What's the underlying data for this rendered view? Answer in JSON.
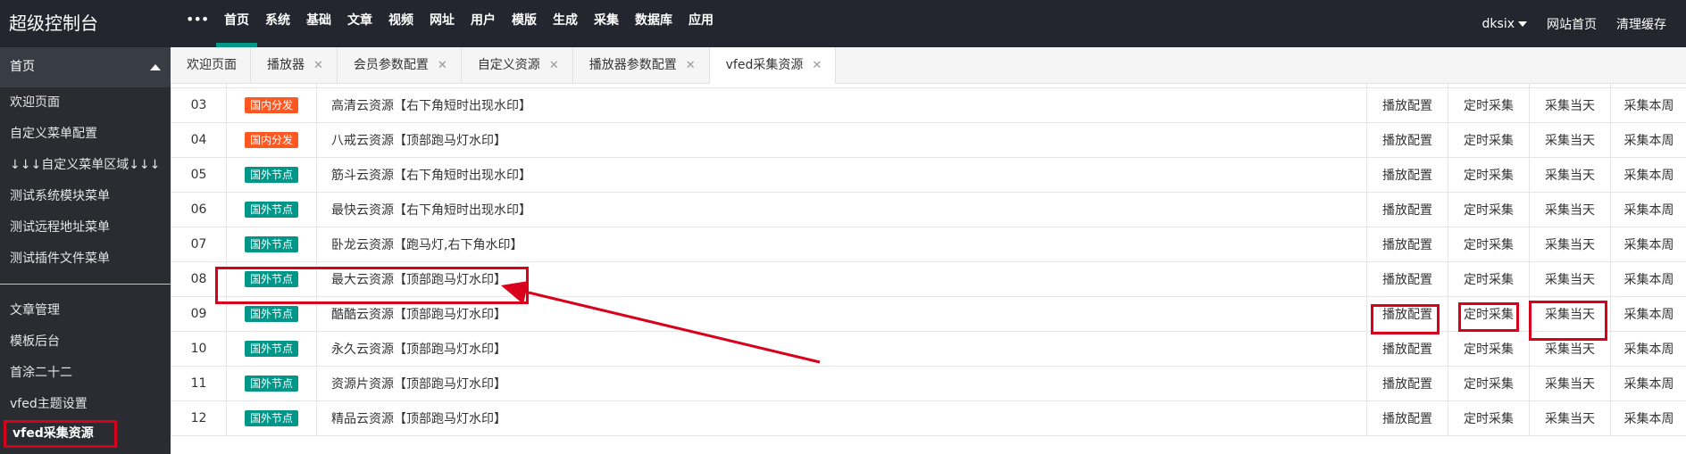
{
  "app": {
    "title": "超级控制台"
  },
  "topnav": {
    "items": [
      {
        "label": "首页"
      },
      {
        "label": "系统"
      },
      {
        "label": "基础"
      },
      {
        "label": "文章"
      },
      {
        "label": "视频"
      },
      {
        "label": "网址"
      },
      {
        "label": "用户"
      },
      {
        "label": "模版"
      },
      {
        "label": "生成"
      },
      {
        "label": "采集"
      },
      {
        "label": "数据库"
      },
      {
        "label": "应用"
      }
    ],
    "active_index": 0,
    "accent_color": "#009688"
  },
  "topright": {
    "user": "dksix",
    "home_link": "网站首页",
    "clear_cache": "清理缓存"
  },
  "sidebar": {
    "header": "首页",
    "group1": [
      "欢迎页面",
      "自定义菜单配置",
      "↓↓↓自定义菜单区域↓↓↓",
      "测试系统模块菜单",
      "测试远程地址菜单",
      "测试插件文件菜单"
    ],
    "group2": [
      "文章管理",
      "模板后台",
      "首涂二十二",
      "vfed主题设置",
      "vfed采集资源"
    ],
    "highlight_color": "#d9001b"
  },
  "tabs": [
    {
      "label": "欢迎页面",
      "closable": false
    },
    {
      "label": "播放器",
      "closable": true
    },
    {
      "label": "会员参数配置",
      "closable": true
    },
    {
      "label": "自定义资源",
      "closable": true
    },
    {
      "label": "播放器参数配置",
      "closable": true
    },
    {
      "label": "vfed采集资源",
      "closable": true,
      "active": true
    }
  ],
  "table": {
    "actions": [
      "播放配置",
      "定时采集",
      "采集当天",
      "采集本周"
    ],
    "tag_colors": {
      "国内分发": "#ff5722",
      "国外节点": "#009688"
    },
    "rows": [
      {
        "num": "03",
        "tag": "国内分发",
        "name": "高清云资源【右下角短时出现水印】"
      },
      {
        "num": "04",
        "tag": "国内分发",
        "name": "八戒云资源【顶部跑马灯水印】"
      },
      {
        "num": "05",
        "tag": "国外节点",
        "name": "筋斗云资源【右下角短时出现水印】"
      },
      {
        "num": "06",
        "tag": "国外节点",
        "name": "最快云资源【右下角短时出现水印】"
      },
      {
        "num": "07",
        "tag": "国外节点",
        "name": "卧龙云资源【跑马灯,右下角水印】"
      },
      {
        "num": "08",
        "tag": "国外节点",
        "name": "最大云资源【顶部跑马灯水印】"
      },
      {
        "num": "09",
        "tag": "国外节点",
        "name": "酷酷云资源【顶部跑马灯水印】"
      },
      {
        "num": "10",
        "tag": "国外节点",
        "name": "永久云资源【顶部跑马灯水印】"
      },
      {
        "num": "11",
        "tag": "国外节点",
        "name": "资源片资源【顶部跑马灯水印】"
      },
      {
        "num": "12",
        "tag": "国外节点",
        "name": "精品云资源【顶部跑马灯水印】"
      }
    ]
  }
}
